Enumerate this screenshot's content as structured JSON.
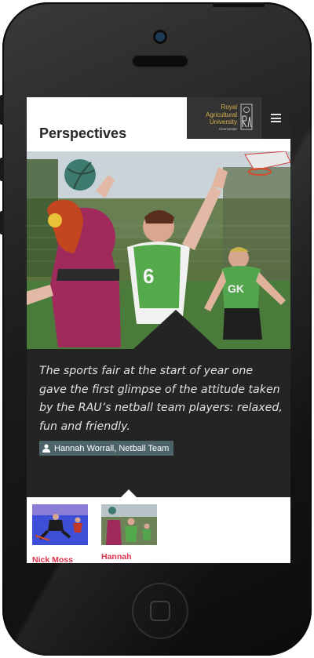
{
  "header": {
    "title": "Perspectives",
    "logo": {
      "lines": [
        "Royal",
        "Agricultural",
        "University"
      ],
      "subtitle": "Cirencester"
    },
    "menu_icon": "hamburger-menu-icon"
  },
  "hero": {
    "image": "netball-match-photo"
  },
  "caption": {
    "quote": "The sports fair at the start of year one gave the first glimpse of the attitude taken by the RAU’s netball team players: relaxed, fun and friendly.",
    "author": "Hannah Worrall, Netball Team",
    "author_icon": "user-icon"
  },
  "thumbnails": [
    {
      "name": "Nick Moss",
      "image": "field-hockey-thumbnail"
    },
    {
      "name": "Hannah",
      "image": "netball-thumbnail"
    }
  ],
  "colors": {
    "panel": "#242424",
    "badge": "#4c6468",
    "accent_name": "#d9334c",
    "logo_gold": "#d9b34a"
  }
}
